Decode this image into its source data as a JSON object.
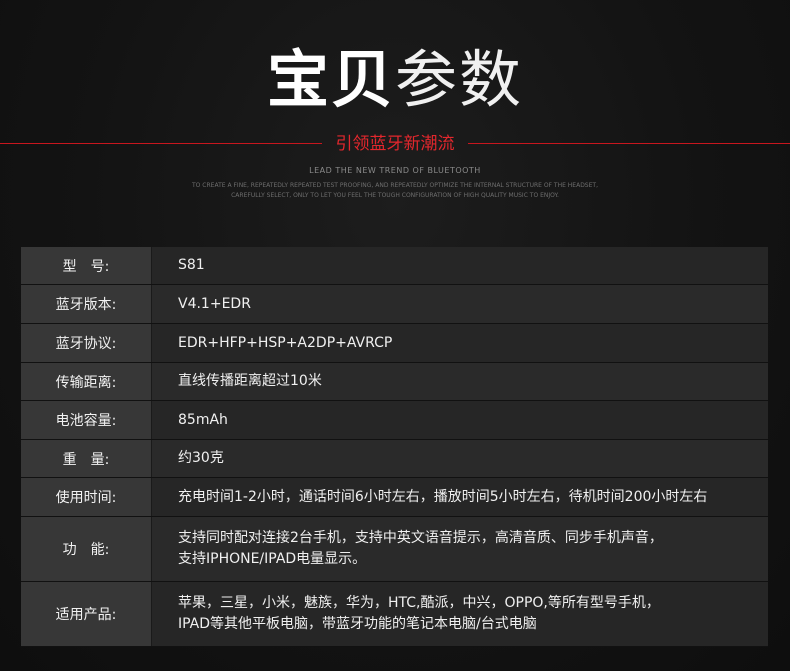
{
  "header": {
    "title_strong": "宝贝",
    "title_light": "参数",
    "slogan": "引领蓝牙新潮流",
    "english_title": "LEAD THE NEW TREND OF BLUETOOTH",
    "english_body": "TO CREATE A FINE, REPEATEDLY REPEATED TEST PROOFING, AND REPEATEDLY OPTIMIZE THE INTERNAL STRUCTURE OF THE HEADSET, CAREFULLY SELECT, ONLY TO LET YOU FEEL THE TOUGH CONFIGURATION OF HIGH QUALITY MUSIC TO ENJOY.",
    "accent_color": "#e3272d"
  },
  "specs": [
    {
      "label": "型　号:",
      "lines": [
        "S81"
      ]
    },
    {
      "label": "蓝牙版本:",
      "lines": [
        "V4.1+EDR"
      ]
    },
    {
      "label": "蓝牙协议:",
      "lines": [
        "EDR+HFP+HSP+A2DP+AVRCP"
      ]
    },
    {
      "label": "传输距离:",
      "lines": [
        "直线传播距离超过10米"
      ]
    },
    {
      "label": "电池容量:",
      "lines": [
        "85mAh"
      ]
    },
    {
      "label": "重　量:",
      "lines": [
        "约30克"
      ]
    },
    {
      "label": "使用时间:",
      "lines": [
        "充电时间1-2小时，通话时间6小时左右，播放时间5小时左右，待机时间200小时左右"
      ]
    },
    {
      "label": "功　能:",
      "lines": [
        "支持同时配对连接2台手机，支持中英文语音提示，高清音质、同步手机声音，",
        "支持IPHONE/IPAD电量显示。"
      ]
    },
    {
      "label": "适用产品:",
      "lines": [
        "苹果，三星，小米，魅族，华为，HTC,酷派，中兴，OPPO,等所有型号手机，",
        "IPAD等其他平板电脑，带蓝牙功能的笔记本电脑/台式电脑"
      ]
    }
  ]
}
